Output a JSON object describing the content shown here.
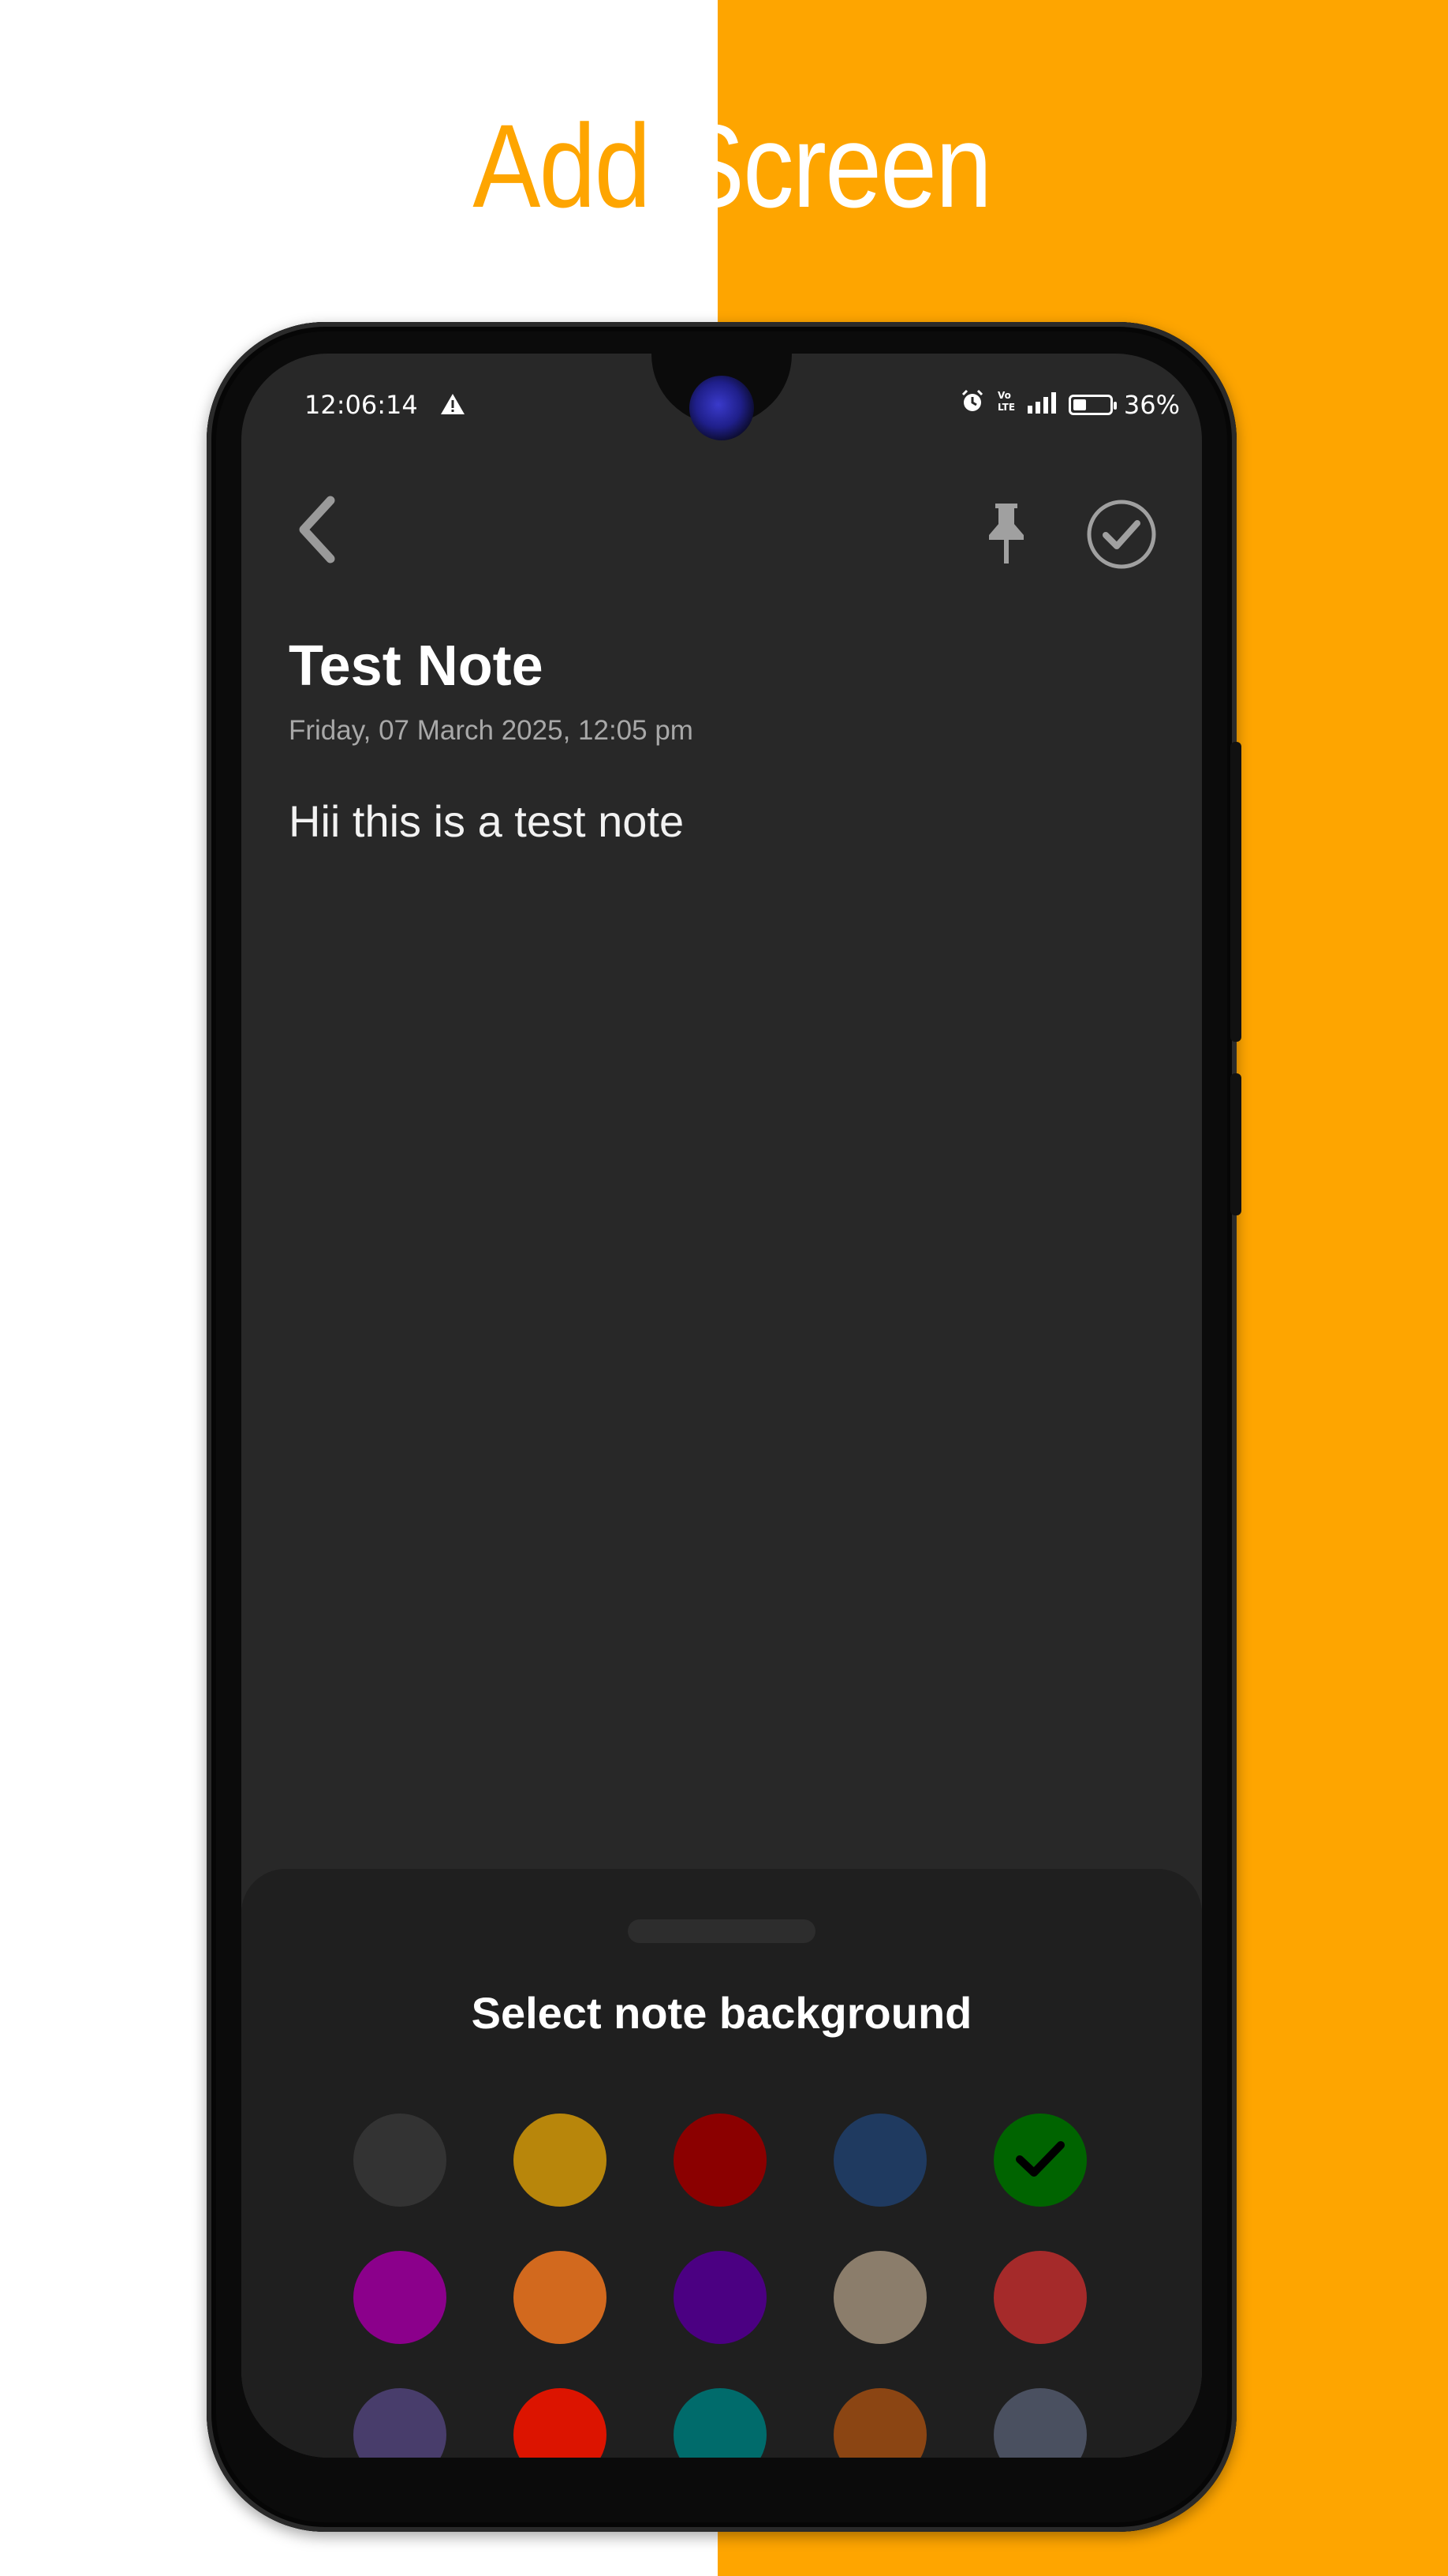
{
  "promo": {
    "title_word1": "Add",
    "title_word2": "Screen",
    "accent_color": "#FEA500"
  },
  "status_bar": {
    "time": "12:06:14",
    "battery": "36%",
    "battery_level": 0.36,
    "icons": [
      "warning-icon",
      "alarm-icon",
      "volte-icon",
      "signal-icon",
      "battery-icon"
    ]
  },
  "toolbar": {
    "back_icon": "chevron-left-icon",
    "pin_icon": "pin-icon",
    "save_icon": "check-circle-icon"
  },
  "note": {
    "title": "Test Note",
    "date": "Friday, 07 March 2025, 12:05 pm",
    "body": "Hii this is a test note",
    "background": "#282828"
  },
  "sheet": {
    "title": "Select note background",
    "selected_index": 4,
    "colors": [
      "#333333",
      "#B8860B",
      "#8B0000",
      "#1F3A60",
      "#006400",
      "#8B008B",
      "#D2691E",
      "#4B0082",
      "#8B7D6B",
      "#A52A2A",
      "#483D6B",
      "#DC1400",
      "#006B6B",
      "#8B4513",
      "#4A5060"
    ]
  }
}
